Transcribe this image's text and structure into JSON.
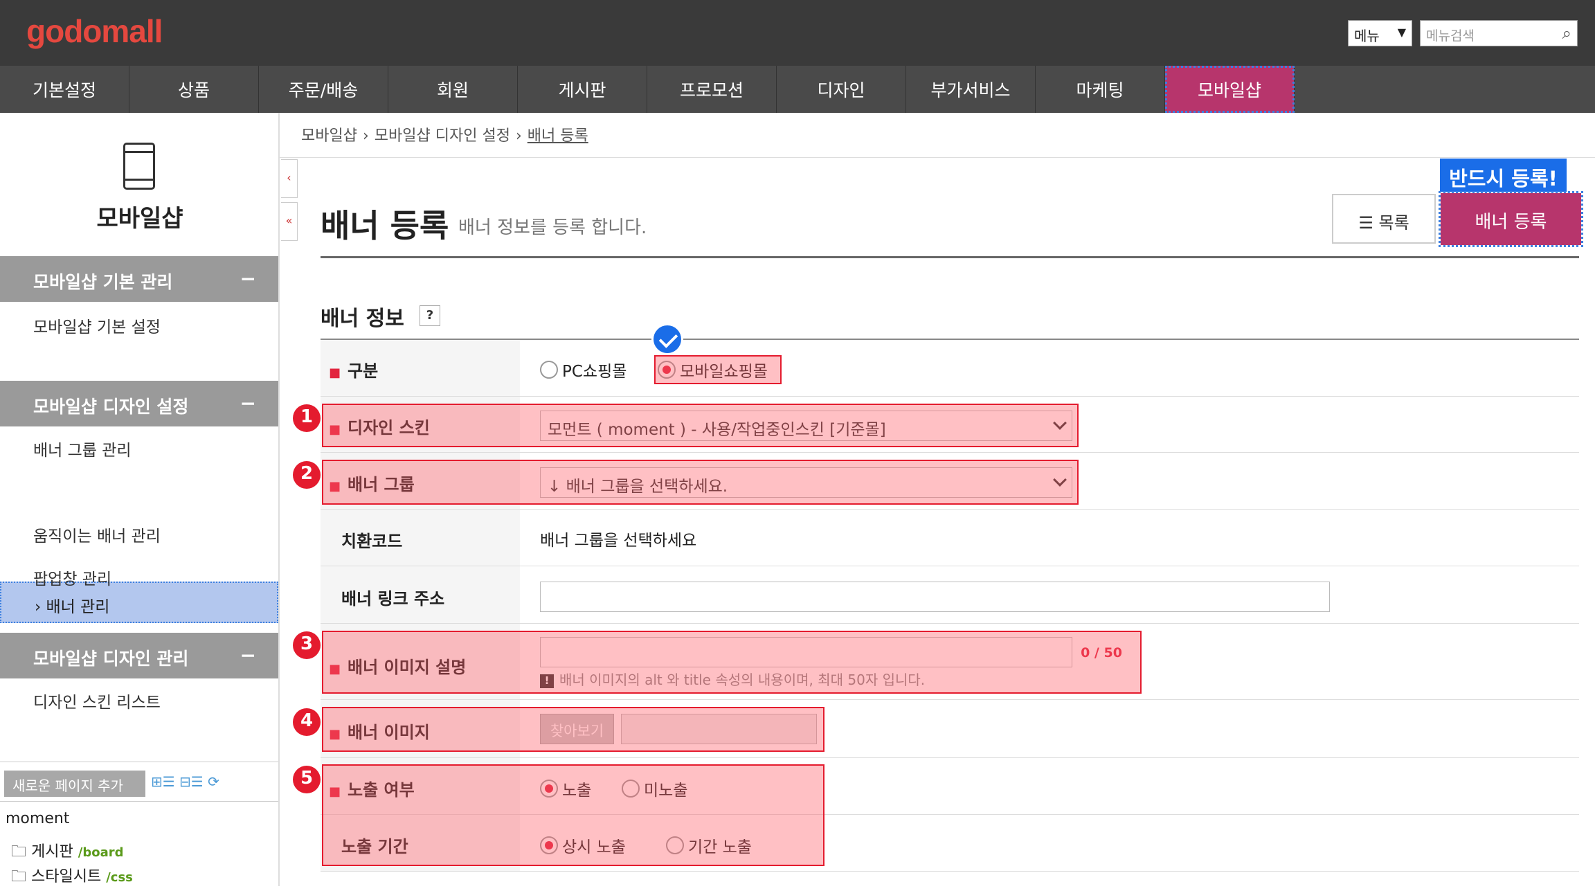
{
  "header": {
    "logo": "godomall",
    "menu_select": "메뉴",
    "menu_search_placeholder": "메뉴검색"
  },
  "gnb": [
    "기본설정",
    "상품",
    "주문/배송",
    "회원",
    "게시판",
    "프로모션",
    "디자인",
    "부가서비스",
    "마케팅",
    "모바일샵"
  ],
  "sidebar": {
    "title": "모바일샵",
    "sections": [
      {
        "title": "모바일샵 기본 관리",
        "items": [
          "모바일샵 기본 설정"
        ]
      },
      {
        "title": "모바일샵 디자인 설정",
        "items": [
          "배너 그룹 관리",
          "배너 관리",
          "움직이는 배너 관리",
          "팝업창 관리"
        ]
      },
      {
        "title": "모바일샵 디자인 관리",
        "items": [
          "디자인 스킨 리스트"
        ]
      }
    ],
    "collapse_symbol": "−",
    "active_prefix": "›",
    "add_page_button": "새로운 페이지 추가",
    "tree_root": "moment",
    "tree": [
      {
        "name": "게시판",
        "path": "/board"
      },
      {
        "name": "스타일시트",
        "path": "/css"
      }
    ]
  },
  "breadcrumb": [
    "모바일샵",
    "모바일샵 디자인 설정",
    "배너 등록"
  ],
  "breadcrumb_sep": "›",
  "page": {
    "title": "배너 등록",
    "description": "배너 정보를 등록 합니다.",
    "list_button": "목록",
    "save_button": "배너 등록",
    "must_label": "반드시 등록!"
  },
  "form": {
    "section_title": "배너 정보",
    "help": "?",
    "division_label": "구분",
    "division_options": [
      "PC쇼핑몰",
      "모바일쇼핑몰"
    ],
    "skin_label": "디자인 스킨",
    "skin_value": "모먼트 ( moment ) - 사용/작업중인스킨 [기준몰]",
    "group_label": "배너 그룹",
    "group_value": "↓ 배너 그룹을 선택하세요.",
    "code_label": "치환코드",
    "code_value": "배너 그룹을 선택하세요",
    "link_label": "배너 링크 주소",
    "link_value": "",
    "desc_label": "배너 이미지 설명",
    "desc_value": "",
    "desc_counter": "0 / 50",
    "desc_hint": "배너 이미지의 alt 와 title 속성의 내용이며, 최대 50자 입니다.",
    "hint_icon": "!",
    "image_label": "배너 이미지",
    "image_button": "찾아보기",
    "display_label": "노출 여부",
    "display_options": [
      "노출",
      "미노출"
    ],
    "period_label": "노출 기간",
    "period_options": [
      "상시 노출",
      "기간 노출"
    ]
  },
  "annotations": {
    "numbers": [
      "1",
      "2",
      "3",
      "4",
      "5"
    ],
    "highlight_color": "#e41b2e",
    "check_color": "#1a6de8"
  },
  "colors": {
    "accent": "#b7356c",
    "topbar": "#3a3a3a",
    "required": "#e2253f"
  }
}
